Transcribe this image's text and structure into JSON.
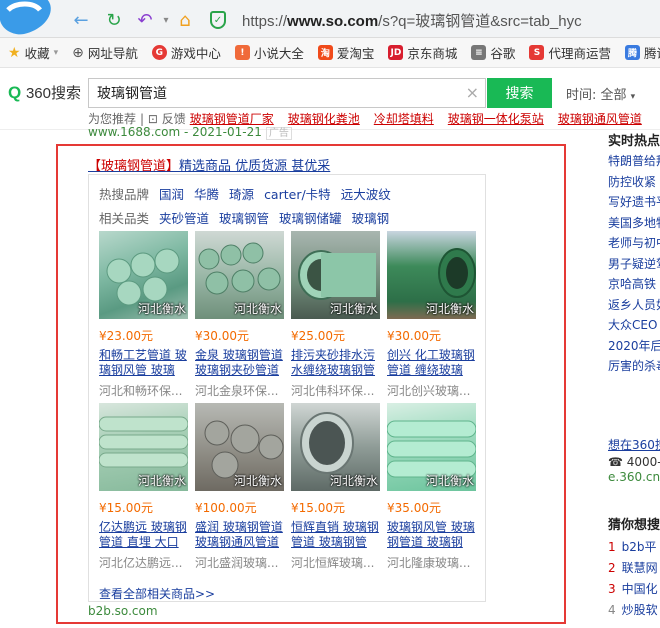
{
  "browser": {
    "url_prefix": "https://",
    "url_domain": "www.so.com",
    "url_path": "/s?q=玻璃钢管道&src=tab_hyc"
  },
  "bookmarks": [
    "收藏",
    "网址导航",
    "游戏中心",
    "小说大全",
    "爱淘宝",
    "京东商城",
    "谷歌",
    "代理商运营",
    "腾讯"
  ],
  "search": {
    "logo": "360",
    "logo_suffix": "搜索",
    "query": "玻璃钢管道",
    "button": "搜索",
    "time_filter": "时间: 全部",
    "suggest_label": "为您推荐",
    "suggest_label2": "| ⊡ 反馈",
    "suggestions": [
      "玻璃钢管道厂家",
      "玻璃钢化粪池",
      "冷却塔填料",
      "玻璃钢一体化泵站",
      "玻璃钢通风管道"
    ]
  },
  "results": {
    "prev_url": "www.1688.com - 2021-01-21",
    "prev_ad_tag": "广告",
    "ad_title_hl": "【玻璃钢管道】",
    "ad_title_rest": "精选商品 优质货源 甚优采",
    "hot_brands_label": "热搜品牌",
    "hot_brands": [
      "国润",
      "华腾",
      "琦源",
      "carter/卡特",
      "远大波纹"
    ],
    "related_label": "相关品类",
    "related": [
      "夹砂管道",
      "玻璃钢管",
      "玻璃钢储罐",
      "玻璃钢"
    ],
    "watermark": "河北衡水",
    "products": [
      {
        "price": "¥23.00元",
        "name": "和畅工艺管道 玻璃钢风管 玻璃",
        "company": "河北和畅环保..."
      },
      {
        "price": "¥30.00元",
        "name": "金泉 玻璃钢管道 玻璃钢夹砂管道",
        "company": "河北金泉环保..."
      },
      {
        "price": "¥25.00元",
        "name": "排污夹砂排水污水缠绕玻璃钢管",
        "company": "河北伟科环保..."
      },
      {
        "price": "¥30.00元",
        "name": "创兴 化工玻璃钢管道 缠绕玻璃",
        "company": "河北创兴玻璃..."
      },
      {
        "price": "¥15.00元",
        "name": "亿达鹏远 玻璃钢管道 直埋 大口",
        "company": "河北亿达鹏远..."
      },
      {
        "price": "¥100.00元",
        "name": "盛润 玻璃钢管道 玻璃钢通风管道",
        "company": "河北盛润玻璃..."
      },
      {
        "price": "¥15.00元",
        "name": "恒辉直销 玻璃钢管道 玻璃钢管",
        "company": "河北恒辉玻璃..."
      },
      {
        "price": "¥35.00元",
        "name": "玻璃钢风管 玻璃钢管道 玻璃钢",
        "company": "河北隆康玻璃..."
      }
    ],
    "view_all": "查看全部相关商品>>",
    "source": "b2b.so.com"
  },
  "sidebar": {
    "hot_title": "实时热点",
    "hot_items": [
      "特朗普给拜",
      "防控收紧",
      "写好遗书平",
      "美国多地物",
      "老师与初中",
      "男子疑逆驾",
      "京哈高铁",
      "返乡人员如",
      "大众CEO",
      "2020年后",
      "厉害的杀毒"
    ],
    "ad_link": "想在360搜",
    "phone": "☎ 4000-",
    "site": "e.360.cn",
    "guess_title": "猜你想搜",
    "guess": [
      {
        "n": "1",
        "t": "b2b平"
      },
      {
        "n": "2",
        "t": "联慧网"
      },
      {
        "n": "3",
        "t": "中国化"
      },
      {
        "n": "4",
        "t": "炒股软"
      }
    ]
  },
  "colors": {
    "accent": "#19b955",
    "link": "#1a3e9e",
    "highlight": "#e53935",
    "price": "#f36a00"
  }
}
